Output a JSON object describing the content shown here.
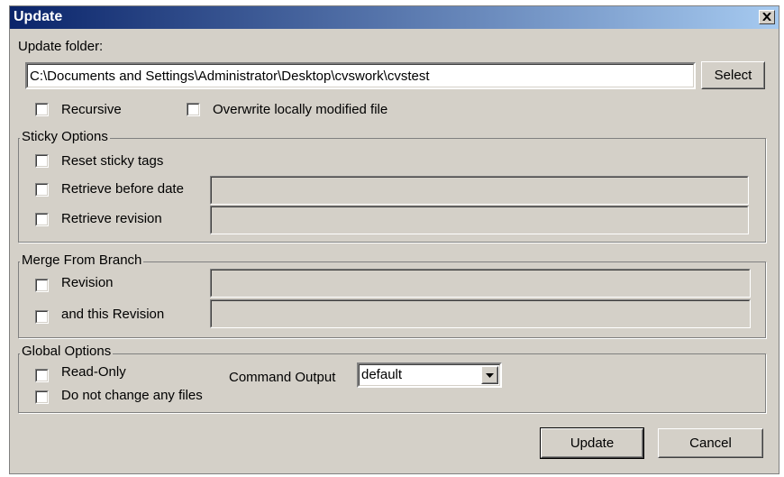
{
  "dialog": {
    "title": "Update"
  },
  "update_folder": {
    "label": "Update folder:",
    "path": "C:\\Documents and Settings\\Administrator\\Desktop\\cvswork\\cvstest",
    "select_label": "Select"
  },
  "options": {
    "recursive": "Recursive",
    "overwrite": "Overwrite locally modified file"
  },
  "sticky": {
    "legend": "Sticky Options",
    "reset": "Reset sticky tags",
    "before_date": "Retrieve before date",
    "revision": "Retrieve revision"
  },
  "merge": {
    "legend": "Merge From Branch",
    "revision": "Revision",
    "and_revision": "and this Revision"
  },
  "global": {
    "legend": "Global Options",
    "read_only": "Read-Only",
    "no_change": "Do not change any files",
    "command_output_label": "Command Output",
    "command_output_value": "default"
  },
  "buttons": {
    "update": "Update",
    "cancel": "Cancel"
  },
  "icons": {
    "close": "close-icon",
    "dropdown": "chevron-down-icon"
  },
  "colors": {
    "titlebar_start": "#0a246a",
    "titlebar_end": "#a6caf0",
    "face": "#d4d0c8"
  }
}
